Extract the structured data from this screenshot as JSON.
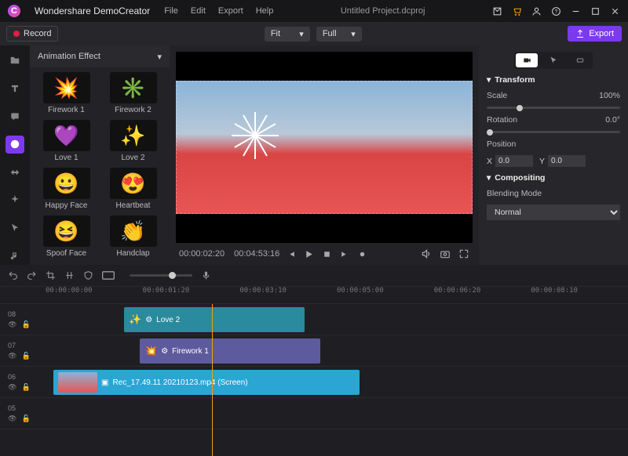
{
  "titlebar": {
    "brand": "Wondershare DemoCreator",
    "menu": [
      "File",
      "Edit",
      "Export",
      "Help"
    ],
    "project": "Untitled Project.dcproj"
  },
  "topbar": {
    "record": "Record",
    "fit": "Fit",
    "full": "Full",
    "export": "Export"
  },
  "assets": {
    "header": "Animation Effect",
    "items": [
      {
        "label": "Firework 1",
        "emoji": "💥"
      },
      {
        "label": "Firework 2",
        "emoji": "✳️"
      },
      {
        "label": "Love 1",
        "emoji": "💜"
      },
      {
        "label": "Love 2",
        "emoji": "✨"
      },
      {
        "label": "Happy Face",
        "emoji": "😀"
      },
      {
        "label": "Heartbeat",
        "emoji": "😍"
      },
      {
        "label": "Spoof Face",
        "emoji": "😆"
      },
      {
        "label": "Handclap",
        "emoji": "👏"
      }
    ]
  },
  "playbar": {
    "current": "00:00:02:20",
    "total": "00:04:53:16"
  },
  "props": {
    "transform": "Transform",
    "scale_label": "Scale",
    "scale_value": "100%",
    "rotation_label": "Rotation",
    "rotation_value": "0.0°",
    "position_label": "Position",
    "x_label": "X",
    "x_value": "0.0",
    "y_label": "Y",
    "y_value": "0.0",
    "compositing": "Compositing",
    "blend_label": "Blending Mode",
    "blend_value": "Normal"
  },
  "ruler": [
    "00:00:00:00",
    "00:00:01:20",
    "00:00:03:10",
    "00:00:05:00",
    "00:00:06:20",
    "00:00:08:10"
  ],
  "tracks": [
    {
      "id": "08"
    },
    {
      "id": "07"
    },
    {
      "id": "06"
    },
    {
      "id": "05"
    }
  ],
  "clips": {
    "love2": "Love 2",
    "firework1": "Firework 1",
    "rec": "Rec_17.49.11 20210123.mp4 (Screen)"
  }
}
